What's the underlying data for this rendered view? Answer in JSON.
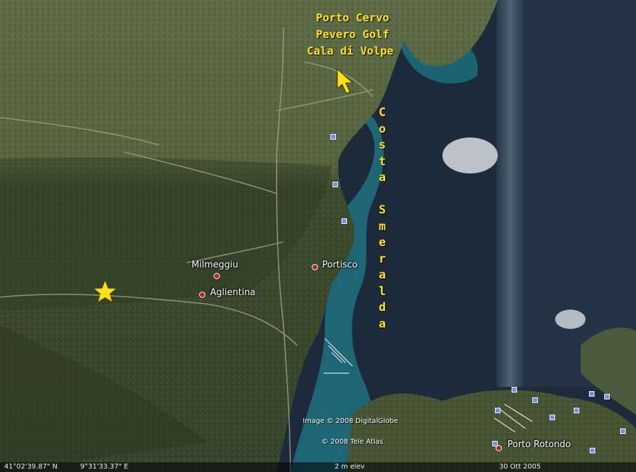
{
  "map": {
    "region_labels": [
      "Porto Cervo",
      "Pevero Golf",
      "Cala di Volpe"
    ],
    "coast_label": [
      "C",
      "o",
      "s",
      "t",
      "a",
      "",
      "S",
      "m",
      "e",
      "r",
      "a",
      "l",
      "d",
      "a"
    ],
    "places": {
      "milmeggiu": "Milmeggiu",
      "aglientina": "Aglientina",
      "portisco": "Portisco",
      "porto_rotondo": "Porto Rotondo"
    },
    "credits": {
      "imagery": "Image © 2008 DigitalGlobe",
      "tele_atlas": "© 2008 Tele Atlas"
    },
    "status": {
      "latitude": "41°02'39.87\" N",
      "longitude": "9°31'33.37\" E",
      "elevation": "2 m elev",
      "date": "30 Ott 2005"
    },
    "icons": {
      "direction_arrow": "arrow-cursor-icon",
      "location_marker": "star-icon"
    },
    "colors": {
      "label_yellow": "#ffe21a",
      "place_dot": "#b42626",
      "sea_deep": "#1d2a38",
      "land": "#4b5a38"
    }
  }
}
